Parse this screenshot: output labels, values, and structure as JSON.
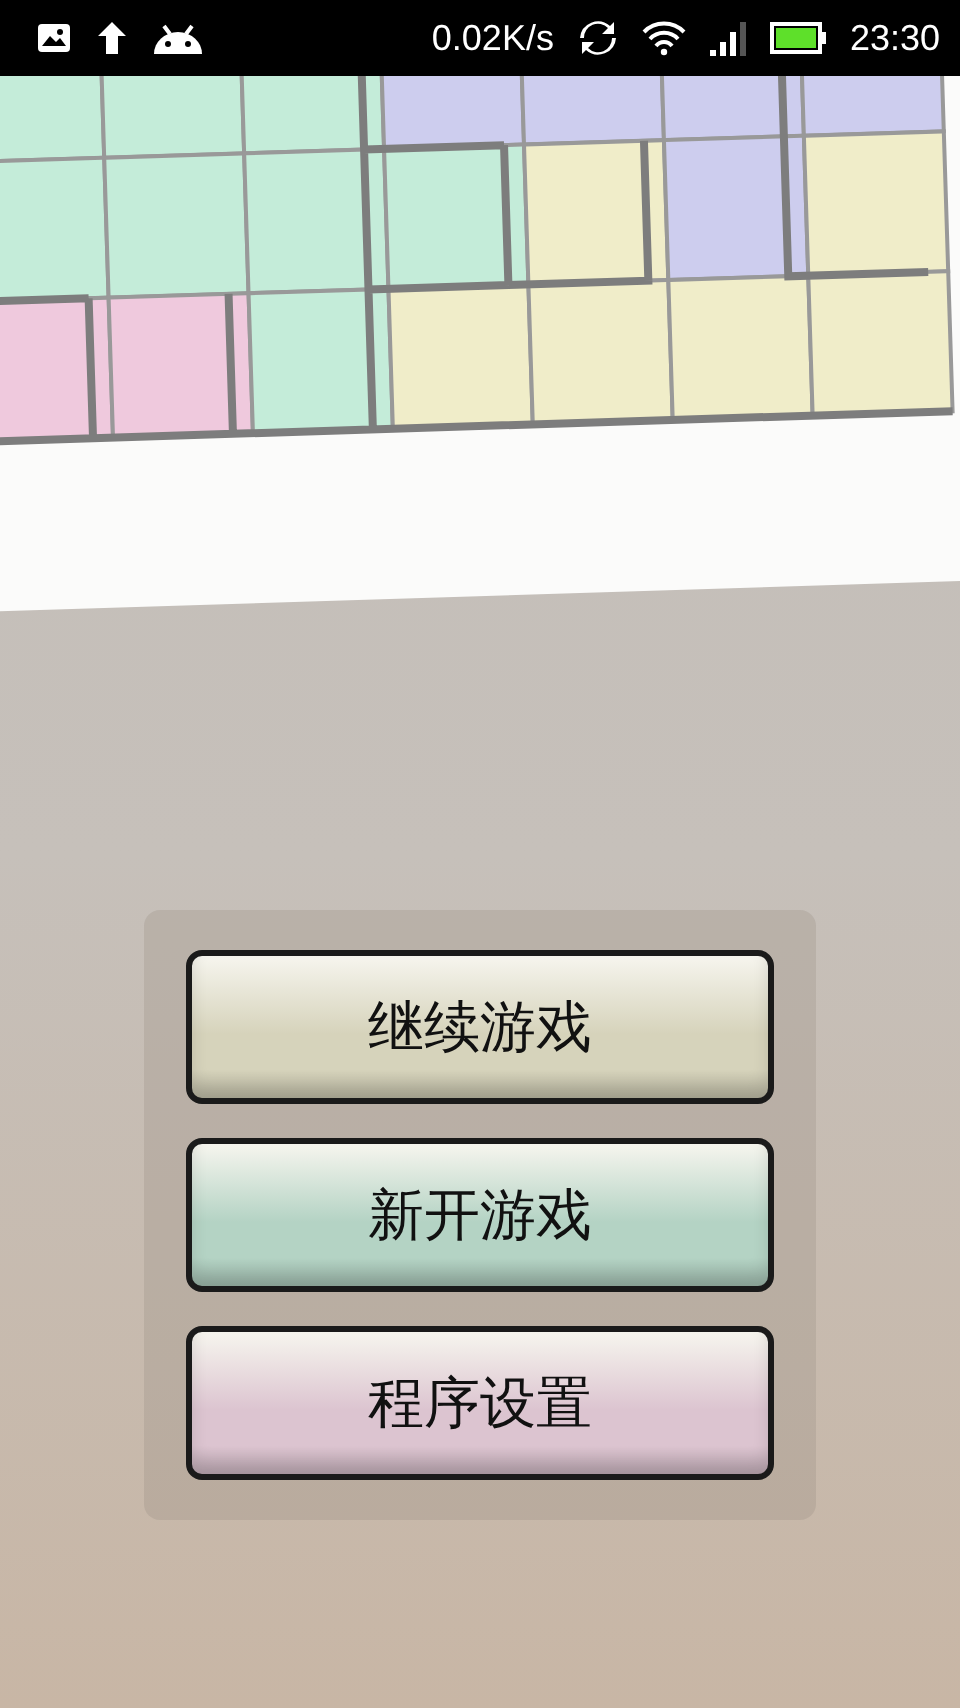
{
  "status_bar": {
    "net_speed": "0.02K/s",
    "time": "23:30"
  },
  "menu": [
    {
      "label": "继续游戏",
      "color": "#d6d3bb"
    },
    {
      "label": "新开游戏",
      "color": "#b4d3c4"
    },
    {
      "label": "程序设置",
      "color": "#dcc4d0"
    }
  ]
}
